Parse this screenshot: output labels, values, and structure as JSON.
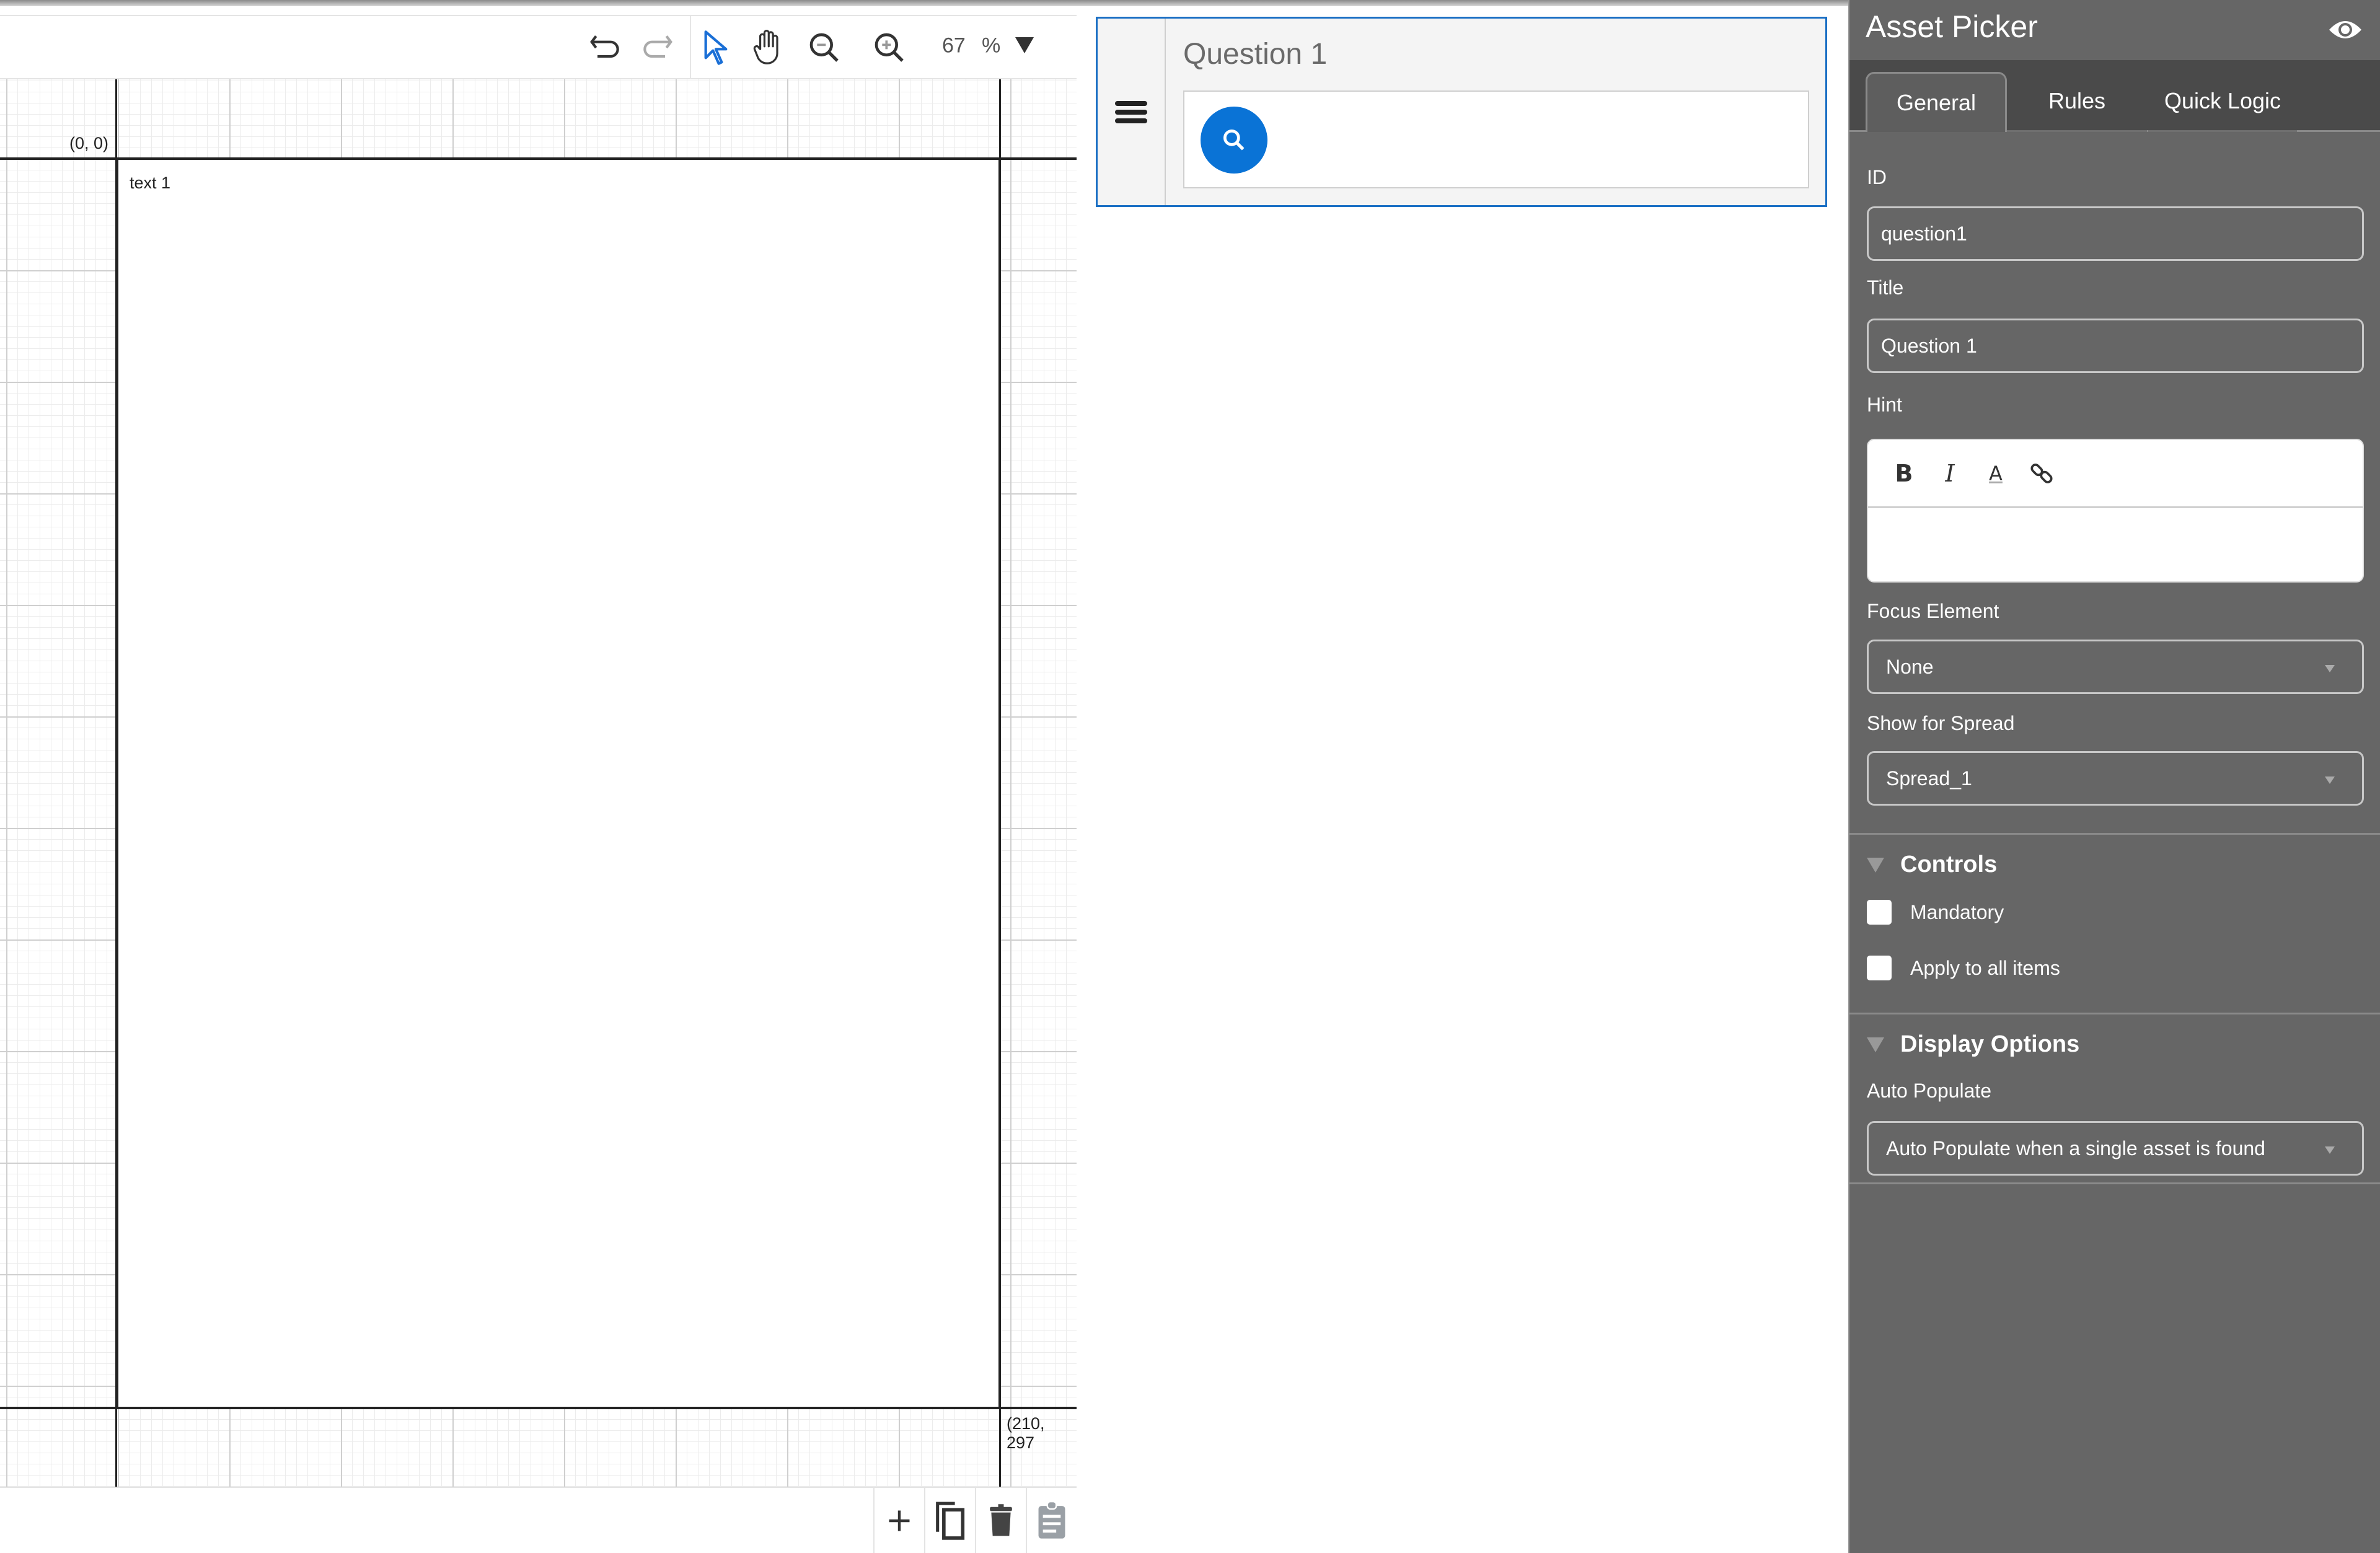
{
  "toolbar": {
    "undo_icon": "undo-icon",
    "redo_icon": "redo-icon",
    "select_icon": "pointer-icon",
    "pan_icon": "hand-icon",
    "zoom_out_icon": "zoom-out-icon",
    "zoom_in_icon": "zoom-in-icon",
    "zoom_value": "67",
    "zoom_unit": "%"
  },
  "canvas": {
    "origin_label": "(0, 0)",
    "extent_label": "(210, 297",
    "page_text": "text 1"
  },
  "bottom_bar": {
    "buttons": [
      {
        "name": "add",
        "icon": "plus-icon"
      },
      {
        "name": "duplicate",
        "icon": "copy-icon"
      },
      {
        "name": "delete",
        "icon": "trash-icon"
      },
      {
        "name": "paste",
        "icon": "clipboard-icon"
      }
    ]
  },
  "question_preview": {
    "title": "Question 1",
    "handle_icon": "drag-handle-icon",
    "search_icon": "search-icon"
  },
  "panel": {
    "title": "Asset Picker",
    "preview_icon": "eye-icon",
    "tabs": [
      {
        "label": "General",
        "active": true
      },
      {
        "label": "Rules",
        "active": false
      },
      {
        "label": "Quick Logic",
        "active": false
      }
    ],
    "fields": {
      "id_label": "ID",
      "id_value": "question1",
      "title_label": "Title",
      "title_value": "Question 1",
      "hint_label": "Hint",
      "hint_toolbar": [
        "B",
        "I",
        "A",
        "link"
      ],
      "hint_value": "",
      "focus_label": "Focus Element",
      "focus_value": "None",
      "spread_label": "Show for Spread",
      "spread_value": "Spread_1"
    },
    "controls": {
      "header": "Controls",
      "mandatory_label": "Mandatory",
      "mandatory_checked": false,
      "apply_all_label": "Apply to all items",
      "apply_all_checked": false
    },
    "display_options": {
      "header": "Display Options",
      "auto_populate_label": "Auto Populate",
      "auto_populate_value": "Auto Populate when a single asset is found"
    }
  },
  "colors": {
    "accent": "#0a73d6",
    "panel_bg": "#666666",
    "tabbar_bg": "#4a4a4a",
    "selection_border": "#1a6fc4"
  }
}
